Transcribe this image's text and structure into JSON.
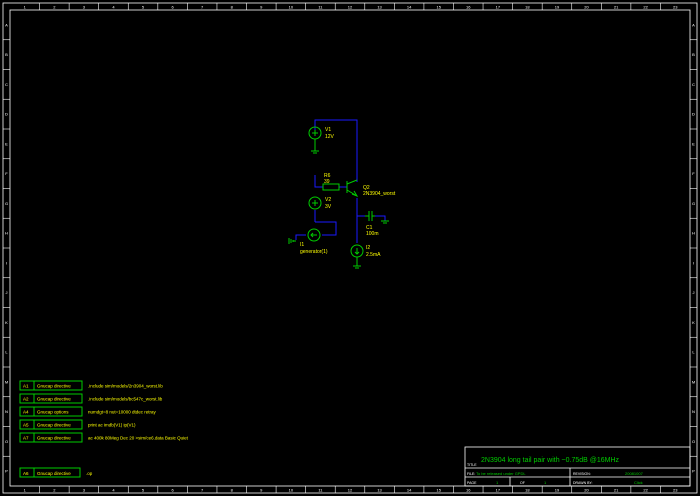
{
  "ruler_numbers": [
    "1",
    "2",
    "3",
    "4",
    "5",
    "6",
    "7",
    "8",
    "9",
    "10",
    "11",
    "12",
    "13",
    "14",
    "15",
    "16",
    "17",
    "18",
    "19",
    "20",
    "21",
    "22",
    "23"
  ],
  "ruler_letters": [
    "A",
    "B",
    "C",
    "D",
    "E",
    "F",
    "G",
    "H",
    "I",
    "J",
    "K",
    "L",
    "M",
    "N",
    "O",
    "P"
  ],
  "components": {
    "v1": {
      "ref": "V1",
      "value": "12V"
    },
    "r6": {
      "ref": "R6",
      "value": "39"
    },
    "v2": {
      "ref": "V2",
      "value": "3V"
    },
    "i1": {
      "ref": "I1",
      "value": "generator(1)"
    },
    "q2": {
      "ref": "Q2",
      "value": "2N3904_worst"
    },
    "c1": {
      "ref": "C1",
      "value": "100m"
    },
    "i2": {
      "ref": "I2",
      "value": "2.5mA"
    }
  },
  "directives": [
    {
      "id": "A1",
      "type": "Gnucap directive",
      "text": ".include sim/models/2n3904_worst.lib"
    },
    {
      "id": "A2",
      "type": "Gnucap directive",
      "text": ".include sim/models/bc547c_worst.lib"
    },
    {
      "id": "A4",
      "type": "Gnucap options",
      "text": "numdgt=8 nut=10000 dtdec retray"
    },
    {
      "id": "A5",
      "type": "Gnucap directive",
      "text": "print ac imdb(V1) ip(V1)"
    },
    {
      "id": "A7",
      "type": "Gnucap directive",
      "text": "ac 400k 80Meg Dec 20 >sim/ce6.data Basic Quiet"
    }
  ],
  "directive_bottom": {
    "id": "A6",
    "type": "Gnucap directive",
    "text": ".op"
  },
  "title_block": {
    "title": "2N3904 long tail pair with ~0.75dB @16MHz",
    "title_label": "TITLE",
    "file_label": "FILE:",
    "file_value": "To be released under GPDL",
    "revision_label": "REVISION:",
    "revision_value": "20081007",
    "page_label": "PAGE",
    "page_value": "1",
    "of_label": "OF",
    "of_value": "1",
    "drawn_label": "DRAWN BY:",
    "drawn_value": "Click"
  },
  "colors": {
    "wire": "#1a1aff",
    "component": "#00cc00",
    "text": "#ffff00",
    "frame": "#ffffff",
    "background": "#000000"
  }
}
